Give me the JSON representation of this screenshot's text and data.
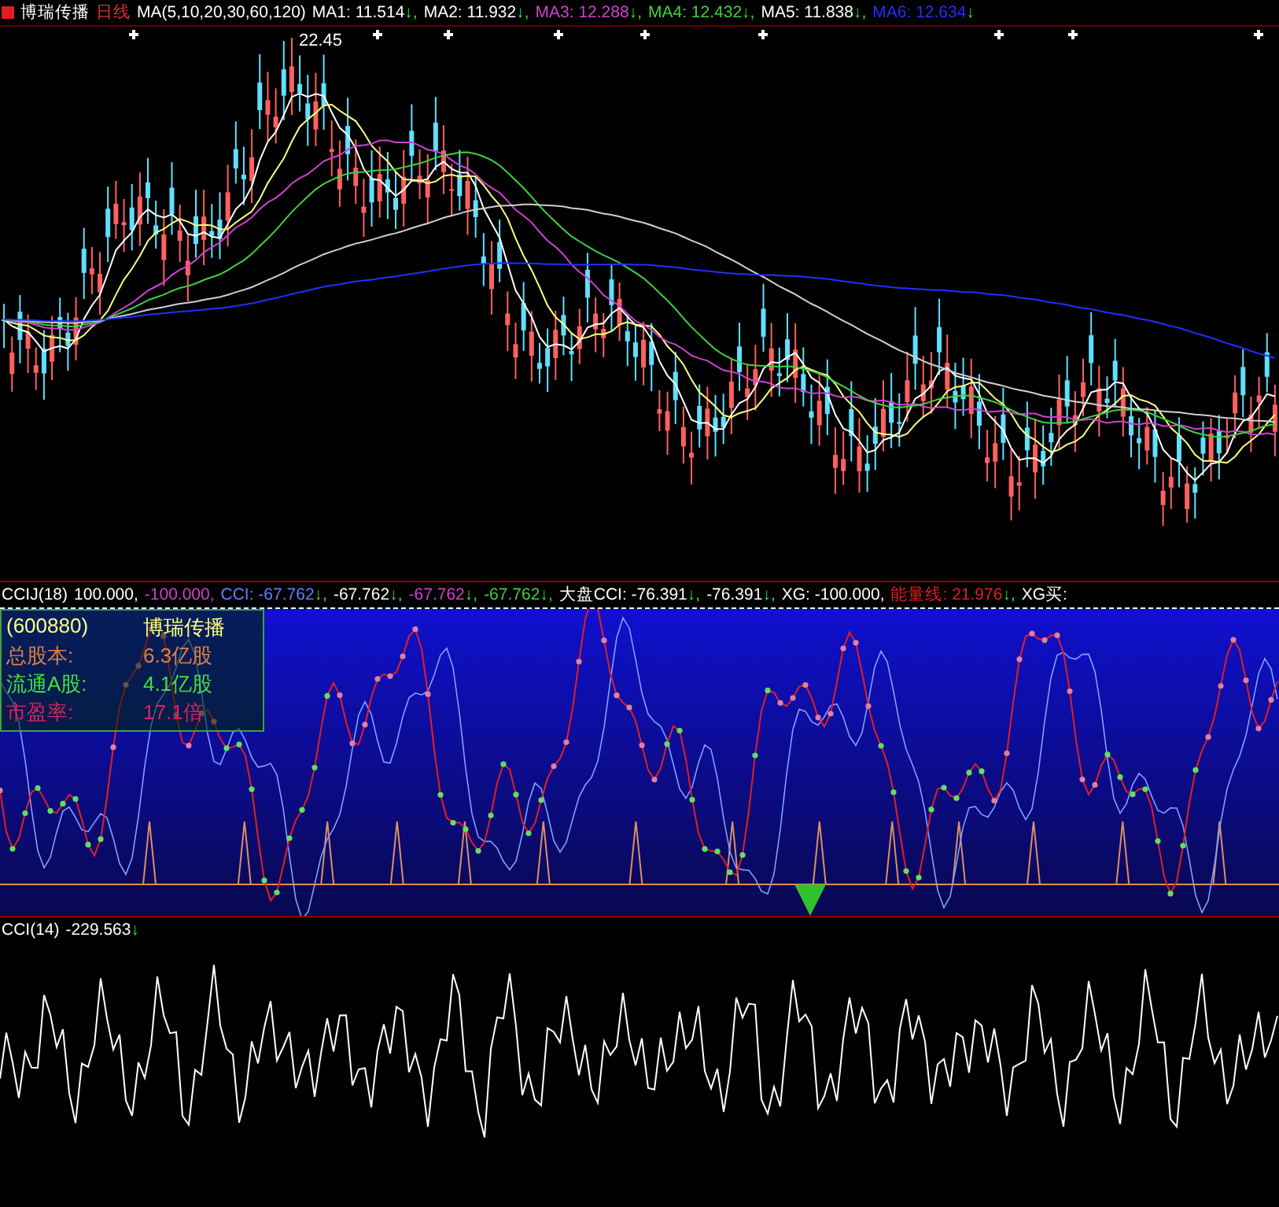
{
  "main_panel": {
    "stock_name": "博瑞传播",
    "period": "日线",
    "indicator": "MA(5,10,20,30,60,120)",
    "readings": [
      {
        "text": "MA1: 11.514",
        "arrow": "↓",
        "sep": ",",
        "color": "#ffffff"
      },
      {
        "text": "MA2: 11.932",
        "arrow": "↓",
        "sep": ",",
        "color": "#ffffff"
      },
      {
        "text": "MA3: 12.288",
        "arrow": "↓",
        "sep": ",",
        "color": "#d040d0"
      },
      {
        "text": "MA4: 12.432",
        "arrow": "↓",
        "sep": ",",
        "color": "#40d040"
      },
      {
        "text": "MA5: 11.838",
        "arrow": "↓",
        "sep": ",",
        "color": "#ffffff"
      },
      {
        "text": "MA6: 12.634",
        "arrow": "↓",
        "color": "#2030ff"
      }
    ],
    "high_label": "22.45"
  },
  "cci_panel": {
    "indicator": "CCIJ(18)",
    "readings": [
      {
        "text": "100.000,",
        "color": "#ffffff"
      },
      {
        "text": "-100.000,",
        "color": "#d040d0"
      },
      {
        "text": "CCI: -67.762",
        "arrow": "↓",
        "sep": ",",
        "color": "#6080ff"
      },
      {
        "text": "-67.762",
        "arrow": "↓",
        "sep": ",",
        "color": "#ffffff"
      },
      {
        "text": "-67.762",
        "arrow": "↓",
        "sep": ",",
        "color": "#d040d0"
      },
      {
        "text": "-67.762",
        "arrow": "↓",
        "sep": ",",
        "color": "#40d040"
      },
      {
        "text": "大盘CCI: -76.391",
        "arrow": "↓",
        "sep": ",",
        "color": "#ffffff"
      },
      {
        "text": "-76.391",
        "arrow": "↓",
        "sep": ",",
        "color": "#ffffff"
      },
      {
        "text": "XG: -100.000,",
        "color": "#ffffff"
      },
      {
        "text": "能量线: 21.976",
        "arrow": "↓",
        "sep": ",",
        "color": "#e02020"
      },
      {
        "text": "XG买:",
        "color": "#ffffff"
      }
    ],
    "info": {
      "code": "(600880)",
      "name": "博瑞传播",
      "rows": [
        {
          "label": "总股本:",
          "value": "6.3亿股",
          "color": "#e08040"
        },
        {
          "label": "流通A股:",
          "value": "4.1亿股",
          "color": "#40e040"
        },
        {
          "label": "市盈率:",
          "value": "17.1倍",
          "color": "#e02060"
        }
      ]
    }
  },
  "cci14_panel": {
    "indicator": "CCI(14)",
    "value": "-229.563",
    "arrow": "↓"
  }
}
